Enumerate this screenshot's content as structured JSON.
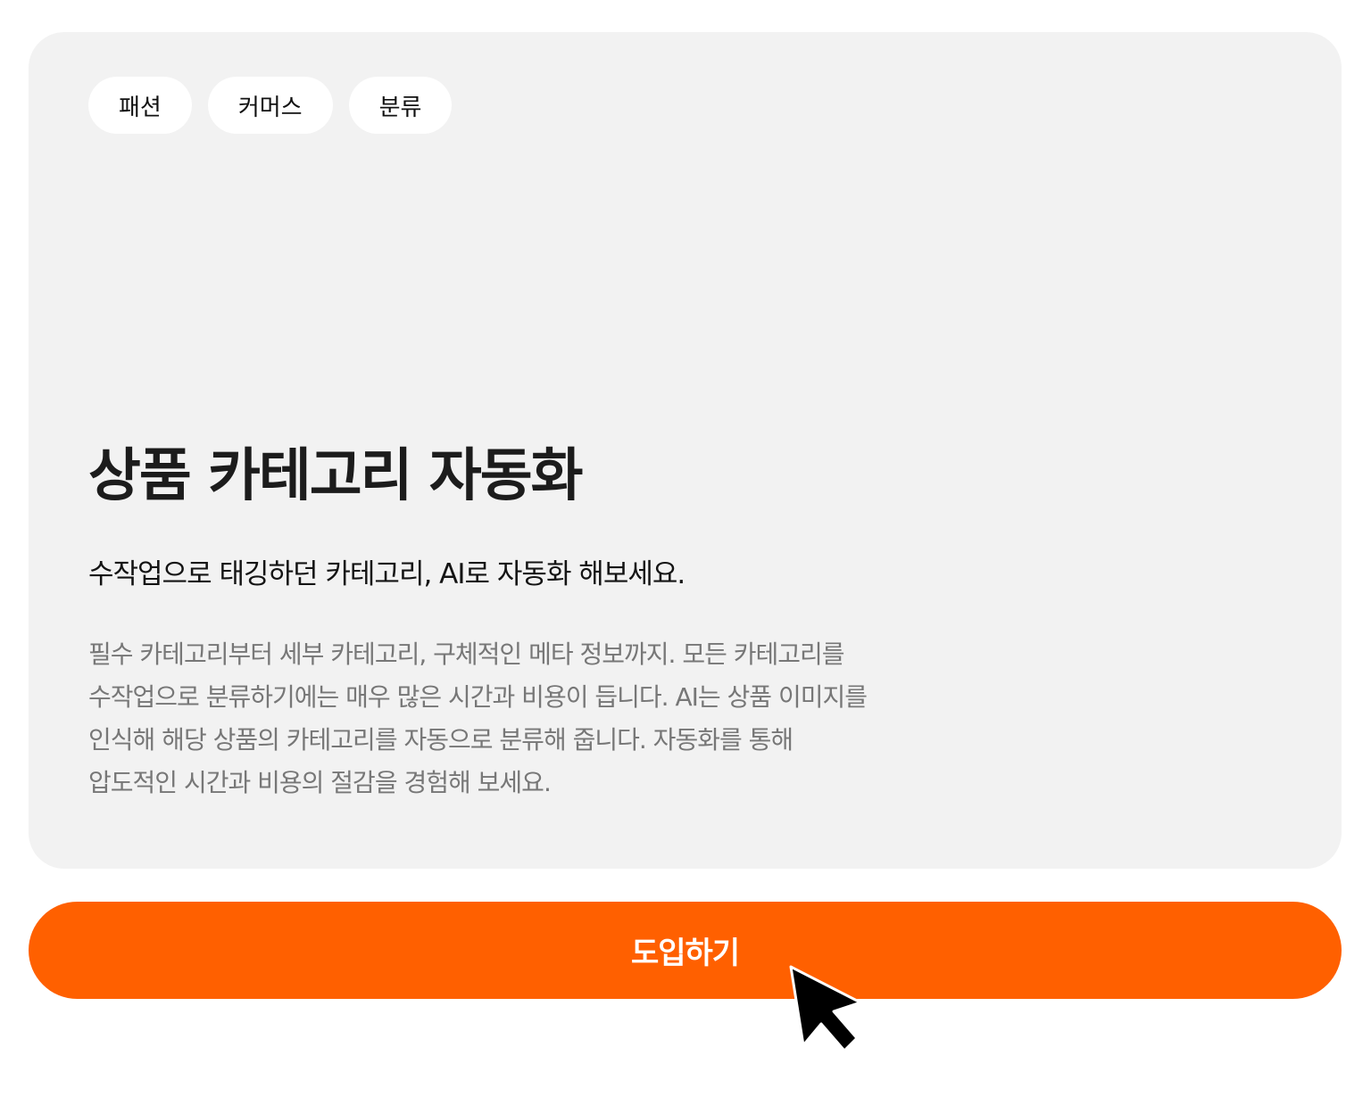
{
  "card": {
    "tags": [
      "패션",
      "커머스",
      "분류"
    ],
    "title": "상품 카테고리 자동화",
    "subtitle": "수작업으로 태깅하던 카테고리, AI로 자동화 해보세요.",
    "description_lines": [
      "필수 카테고리부터 세부 카테고리, 구체적인 메타 정보까지. 모든 카테고리를",
      "수작업으로 분류하기에는 매우 많은 시간과 비용이 듭니다. AI는 상품 이미지를",
      "인식해 해당 상품의 카테고리를 자동으로 분류해 줍니다. 자동화를 통해",
      "압도적인 시간과 비용의 절감을 경험해 보세요."
    ]
  },
  "cta": {
    "label": "도입하기"
  },
  "icons": {
    "cursor": "mouse-pointer-icon"
  },
  "colors": {
    "accent": "#ff6000",
    "card_background": "#f2f2f2",
    "tag_background": "#ffffff",
    "description_text": "#777777"
  }
}
